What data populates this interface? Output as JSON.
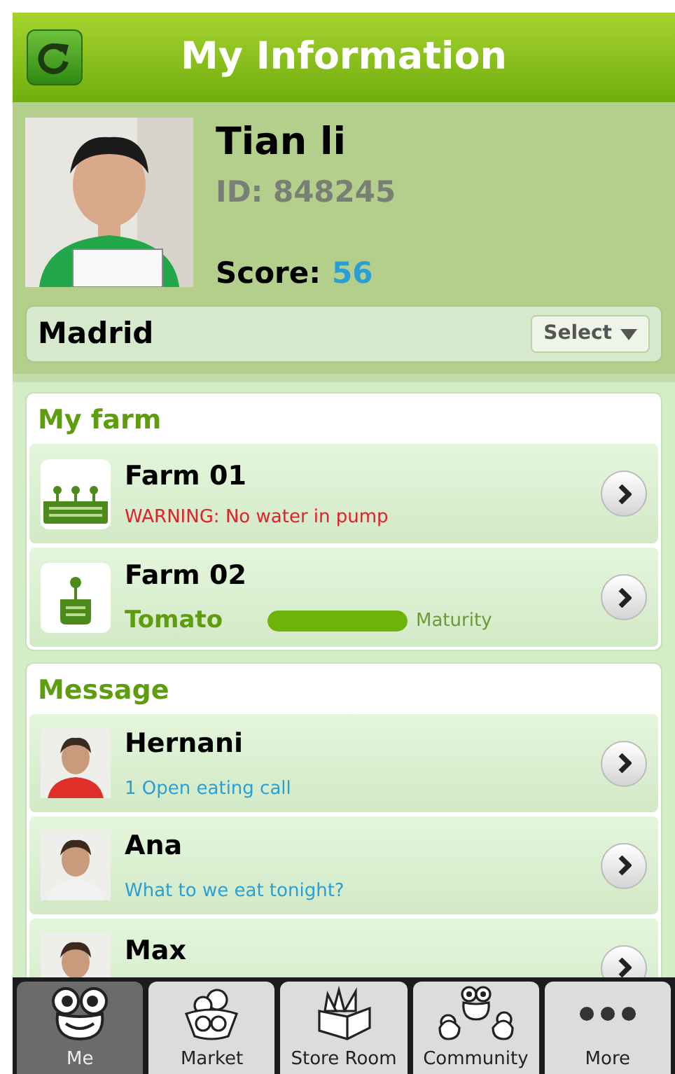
{
  "header": {
    "title": "My Information"
  },
  "profile": {
    "name": "Tian li",
    "id": "ID: 848245",
    "score_label": "Score:",
    "score": "56",
    "city": "Madrid",
    "select": "Select"
  },
  "farm": {
    "title": "My farm",
    "items": [
      {
        "kind": "warning",
        "name": "Farm 01",
        "status": "WARNING: No water in pump"
      },
      {
        "kind": "crop",
        "name": "Farm 02",
        "crop": "Tomato",
        "level": 1,
        "level_label": "Maturity"
      }
    ]
  },
  "messages": {
    "title": "Message",
    "items": [
      {
        "name": "Hernani",
        "text": "1 Open eating call"
      },
      {
        "name": "Ana",
        "text": "What to we eat tonight?"
      },
      {
        "name": "Max"
      }
    ]
  },
  "tabs": [
    {
      "label": "Me",
      "selected": true
    },
    {
      "label": "Market",
      "selected": false
    },
    {
      "label": "Store Room",
      "selected": false
    },
    {
      "label": "Community",
      "selected": false
    },
    {
      "label": "More",
      "selected": false
    }
  ]
}
